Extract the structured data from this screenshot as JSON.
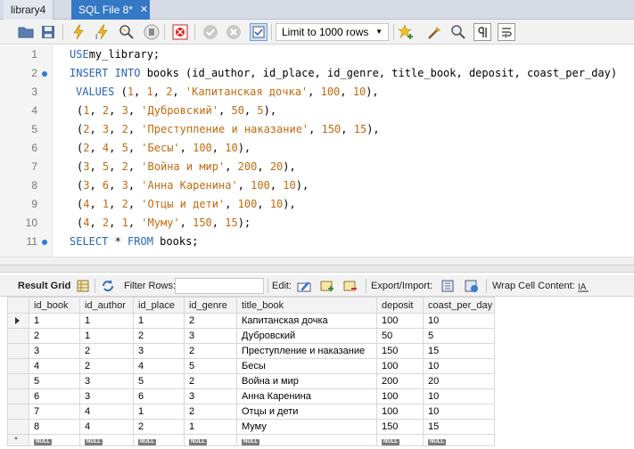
{
  "tabs": [
    {
      "label": "library4",
      "active": false
    },
    {
      "label": "SQL File 8*",
      "active": true
    }
  ],
  "toolbar": {
    "limit_label": "Limit to 1000 rows",
    "icons": [
      "open-folder-icon",
      "save-icon",
      "execute-icon",
      "execute-current-icon",
      "explain-icon",
      "stop-icon",
      "toggle-error-icon",
      "commit-icon",
      "rollback-icon",
      "autocommit-icon",
      "add-snippet-icon",
      "beautify-icon",
      "find-icon",
      "invisible-chars-icon",
      "wrap-icon"
    ]
  },
  "editor": {
    "lines": [
      {
        "n": "1",
        "marker": false,
        "parts": [
          [
            "kw",
            "USE"
          ],
          [
            "",
            "my_library;"
          ]
        ]
      },
      {
        "n": "2",
        "marker": true,
        "parts": [
          [
            "kw",
            "INSERT INTO"
          ],
          [
            "",
            " books (id_author, id_place, id_genre, title_book, deposit, coast_per_day)"
          ]
        ]
      },
      {
        "n": "3",
        "marker": false,
        "parts": [
          [
            "",
            ""
          ],
          [
            "kw",
            "VALUES"
          ],
          [
            "",
            " ("
          ],
          [
            "num",
            "1"
          ],
          [
            "",
            ", "
          ],
          [
            "num",
            "1"
          ],
          [
            "",
            ", "
          ],
          [
            "num",
            "2"
          ],
          [
            "",
            ", "
          ],
          [
            "str",
            "'Капитанская дочка'"
          ],
          [
            "",
            ", "
          ],
          [
            "num",
            "100"
          ],
          [
            "",
            ", "
          ],
          [
            "num",
            "10"
          ],
          [
            "",
            "),"
          ]
        ]
      },
      {
        "n": "4",
        "marker": false,
        "parts": [
          [
            "",
            "("
          ],
          [
            "num",
            "1"
          ],
          [
            "",
            ", "
          ],
          [
            "num",
            "2"
          ],
          [
            "",
            ", "
          ],
          [
            "num",
            "3"
          ],
          [
            "",
            ", "
          ],
          [
            "str",
            "'Дубровский'"
          ],
          [
            "",
            ", "
          ],
          [
            "num",
            "50"
          ],
          [
            "",
            ", "
          ],
          [
            "num",
            "5"
          ],
          [
            "",
            "),"
          ]
        ]
      },
      {
        "n": "5",
        "marker": false,
        "parts": [
          [
            "",
            "("
          ],
          [
            "num",
            "2"
          ],
          [
            "",
            ", "
          ],
          [
            "num",
            "3"
          ],
          [
            "",
            ", "
          ],
          [
            "num",
            "2"
          ],
          [
            "",
            ", "
          ],
          [
            "str",
            "'Преступление и наказание'"
          ],
          [
            "",
            ", "
          ],
          [
            "num",
            "150"
          ],
          [
            "",
            ", "
          ],
          [
            "num",
            "15"
          ],
          [
            "",
            "),"
          ]
        ]
      },
      {
        "n": "6",
        "marker": false,
        "parts": [
          [
            "",
            "("
          ],
          [
            "num",
            "2"
          ],
          [
            "",
            ", "
          ],
          [
            "num",
            "4"
          ],
          [
            "",
            ", "
          ],
          [
            "num",
            "5"
          ],
          [
            "",
            ", "
          ],
          [
            "str",
            "'Бесы'"
          ],
          [
            "",
            ", "
          ],
          [
            "num",
            "100"
          ],
          [
            "",
            ", "
          ],
          [
            "num",
            "10"
          ],
          [
            "",
            "),"
          ]
        ]
      },
      {
        "n": "7",
        "marker": false,
        "parts": [
          [
            "",
            "("
          ],
          [
            "num",
            "3"
          ],
          [
            "",
            ", "
          ],
          [
            "num",
            "5"
          ],
          [
            "",
            ", "
          ],
          [
            "num",
            "2"
          ],
          [
            "",
            ", "
          ],
          [
            "str",
            "'Война и мир'"
          ],
          [
            "",
            ", "
          ],
          [
            "num",
            "200"
          ],
          [
            "",
            ", "
          ],
          [
            "num",
            "20"
          ],
          [
            "",
            "),"
          ]
        ]
      },
      {
        "n": "8",
        "marker": false,
        "parts": [
          [
            "",
            "("
          ],
          [
            "num",
            "3"
          ],
          [
            "",
            ", "
          ],
          [
            "num",
            "6"
          ],
          [
            "",
            ", "
          ],
          [
            "num",
            "3"
          ],
          [
            "",
            ", "
          ],
          [
            "str",
            "'Анна Каренина'"
          ],
          [
            "",
            ", "
          ],
          [
            "num",
            "100"
          ],
          [
            "",
            ", "
          ],
          [
            "num",
            "10"
          ],
          [
            "",
            "),"
          ]
        ]
      },
      {
        "n": "9",
        "marker": false,
        "parts": [
          [
            "",
            "("
          ],
          [
            "num",
            "4"
          ],
          [
            "",
            ", "
          ],
          [
            "num",
            "1"
          ],
          [
            "",
            ", "
          ],
          [
            "num",
            "2"
          ],
          [
            "",
            ", "
          ],
          [
            "str",
            "'Отцы и дети'"
          ],
          [
            "",
            ", "
          ],
          [
            "num",
            "100"
          ],
          [
            "",
            ", "
          ],
          [
            "num",
            "10"
          ],
          [
            "",
            "),"
          ]
        ]
      },
      {
        "n": "10",
        "marker": false,
        "parts": [
          [
            "",
            "("
          ],
          [
            "num",
            "4"
          ],
          [
            "",
            ", "
          ],
          [
            "num",
            "2"
          ],
          [
            "",
            ", "
          ],
          [
            "num",
            "1"
          ],
          [
            "",
            ", "
          ],
          [
            "str",
            "'Муму'"
          ],
          [
            "",
            ", "
          ],
          [
            "num",
            "150"
          ],
          [
            "",
            ", "
          ],
          [
            "num",
            "15"
          ],
          [
            "",
            ");"
          ]
        ]
      },
      {
        "n": "11",
        "marker": true,
        "parts": [
          [
            "kw",
            "SELECT"
          ],
          [
            "",
            " * "
          ],
          [
            "kw",
            "FROM"
          ],
          [
            "",
            " books;"
          ]
        ]
      }
    ]
  },
  "result_toolbar": {
    "result_grid": "Result Grid",
    "filter_rows": "Filter Rows:",
    "filter_value": "",
    "edit": "Edit:",
    "export_import": "Export/Import:",
    "wrap_cell": "Wrap Cell Content:"
  },
  "grid": {
    "columns": [
      "id_book",
      "id_author",
      "id_place",
      "id_genre",
      "title_book",
      "deposit",
      "coast_per_day"
    ],
    "rows": [
      [
        "1",
        "1",
        "1",
        "2",
        "Капитанская дочка",
        "100",
        "10"
      ],
      [
        "2",
        "1",
        "2",
        "3",
        "Дубровский",
        "50",
        "5"
      ],
      [
        "3",
        "2",
        "3",
        "2",
        "Преступление и наказание",
        "150",
        "15"
      ],
      [
        "4",
        "2",
        "4",
        "5",
        "Бесы",
        "100",
        "10"
      ],
      [
        "5",
        "3",
        "5",
        "2",
        "Война и мир",
        "200",
        "20"
      ],
      [
        "6",
        "3",
        "6",
        "3",
        "Анна Каренина",
        "100",
        "10"
      ],
      [
        "7",
        "4",
        "1",
        "2",
        "Отцы и дети",
        "100",
        "10"
      ],
      [
        "8",
        "4",
        "2",
        "1",
        "Муму",
        "150",
        "15"
      ]
    ],
    "null_label": "NULL",
    "new_row_marker": "*"
  },
  "colors": {
    "keyword": "#2c63b8",
    "literal": "#c26a0d",
    "active_tab": "#3478c6"
  }
}
